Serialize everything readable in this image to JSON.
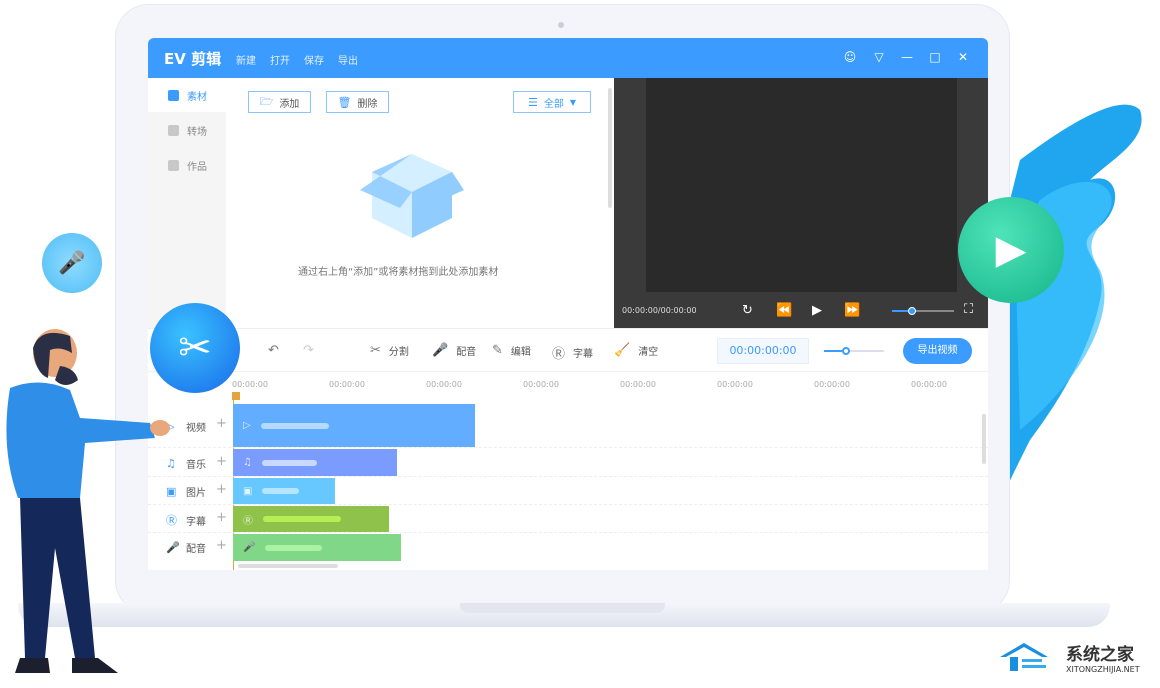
{
  "app": {
    "title": "EV 剪辑",
    "menu": [
      "新建",
      "打开",
      "保存",
      "导出"
    ]
  },
  "window_controls": [
    "user-icon",
    "skin-icon",
    "minimize-icon",
    "maximize-icon",
    "close-icon"
  ],
  "sidebar": {
    "items": [
      {
        "label": "素材",
        "active": true
      },
      {
        "label": "转场"
      },
      {
        "label": "作品"
      }
    ]
  },
  "media": {
    "add_label": "添加",
    "delete_label": "删除",
    "filter_label": "全部",
    "empty_text": "通过右上角“添加”或将素材拖到此处添加素材"
  },
  "preview": {
    "time": "00:00:00/00:00:00",
    "volume": 0.3
  },
  "toolbar": {
    "split": "分割",
    "dub": "配音",
    "edit": "编辑",
    "subtitle": "字幕",
    "clear": "清空",
    "timecode": "00:00:00:00",
    "zoom": 0.3,
    "export": "导出视频"
  },
  "ruler": [
    "00:00:00",
    "00:00:00",
    "00:00:00",
    "00:00:00",
    "00:00:00",
    "00:00:00",
    "00:00:00",
    "00:00:00"
  ],
  "tracks": [
    {
      "label": "视频",
      "color": "#62adff"
    },
    {
      "label": "音乐",
      "color": "#7b9cff"
    },
    {
      "label": "图片",
      "color": "#66c8ff"
    },
    {
      "label": "字幕",
      "color": "#8fc24a"
    },
    {
      "label": "配音",
      "color": "#7fd787"
    }
  ],
  "watermark": {
    "name": "系统之家",
    "url": "XITONGZHIJIA.NET"
  },
  "colors": {
    "accent": "#3b9bff"
  }
}
